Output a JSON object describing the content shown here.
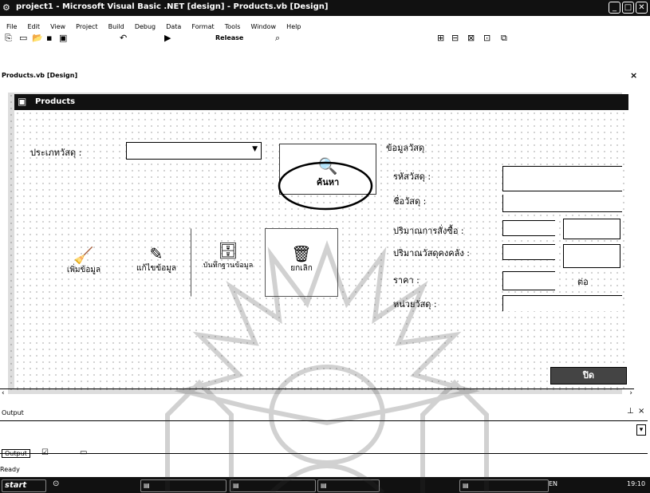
{
  "window": {
    "title": "project1 - Microsoft Visual Basic .NET [design] - Products.vb [Design]",
    "controls": [
      "_",
      "□",
      "✕"
    ]
  },
  "menu": [
    "File",
    "Edit",
    "View",
    "Project",
    "Build",
    "Debug",
    "Data",
    "Format",
    "Tools",
    "Window",
    "Help"
  ],
  "toolbar": {
    "config": "Release"
  },
  "doc_tab": "Products.vb [Design]",
  "form": {
    "title": "Products",
    "type_label": "ประเภทวัสดุ :",
    "search_button": "ค้นหา",
    "info_header": "ข้อมูลวัสดุ",
    "field_labels": [
      "รหัสวัสดุ :",
      "ชื่อวัสดุ :",
      "ปริมาณการสั่งซื้อ :",
      "ปริมาณวัสดุคงคลัง :",
      "ราคา :",
      "หน่วยวัสดุ :"
    ],
    "unit_suffix": "ต่อ",
    "action_buttons": [
      {
        "label": "เพิ่มข้อมูล",
        "icon": "broom-icon"
      },
      {
        "label": "แก้ไขข้อมูล",
        "icon": "edit-icon"
      },
      {
        "label": "บันทึกฐานข้อมูล",
        "icon": "save-db-icon"
      },
      {
        "label": "ยกเลิก",
        "icon": "cancel-icon"
      }
    ],
    "bottom_button": "ปิด"
  },
  "output": {
    "title": "Output",
    "tab": "Output"
  },
  "status": "Ready",
  "taskbar": {
    "start": "start",
    "time": "19:10",
    "lang": "EN"
  }
}
